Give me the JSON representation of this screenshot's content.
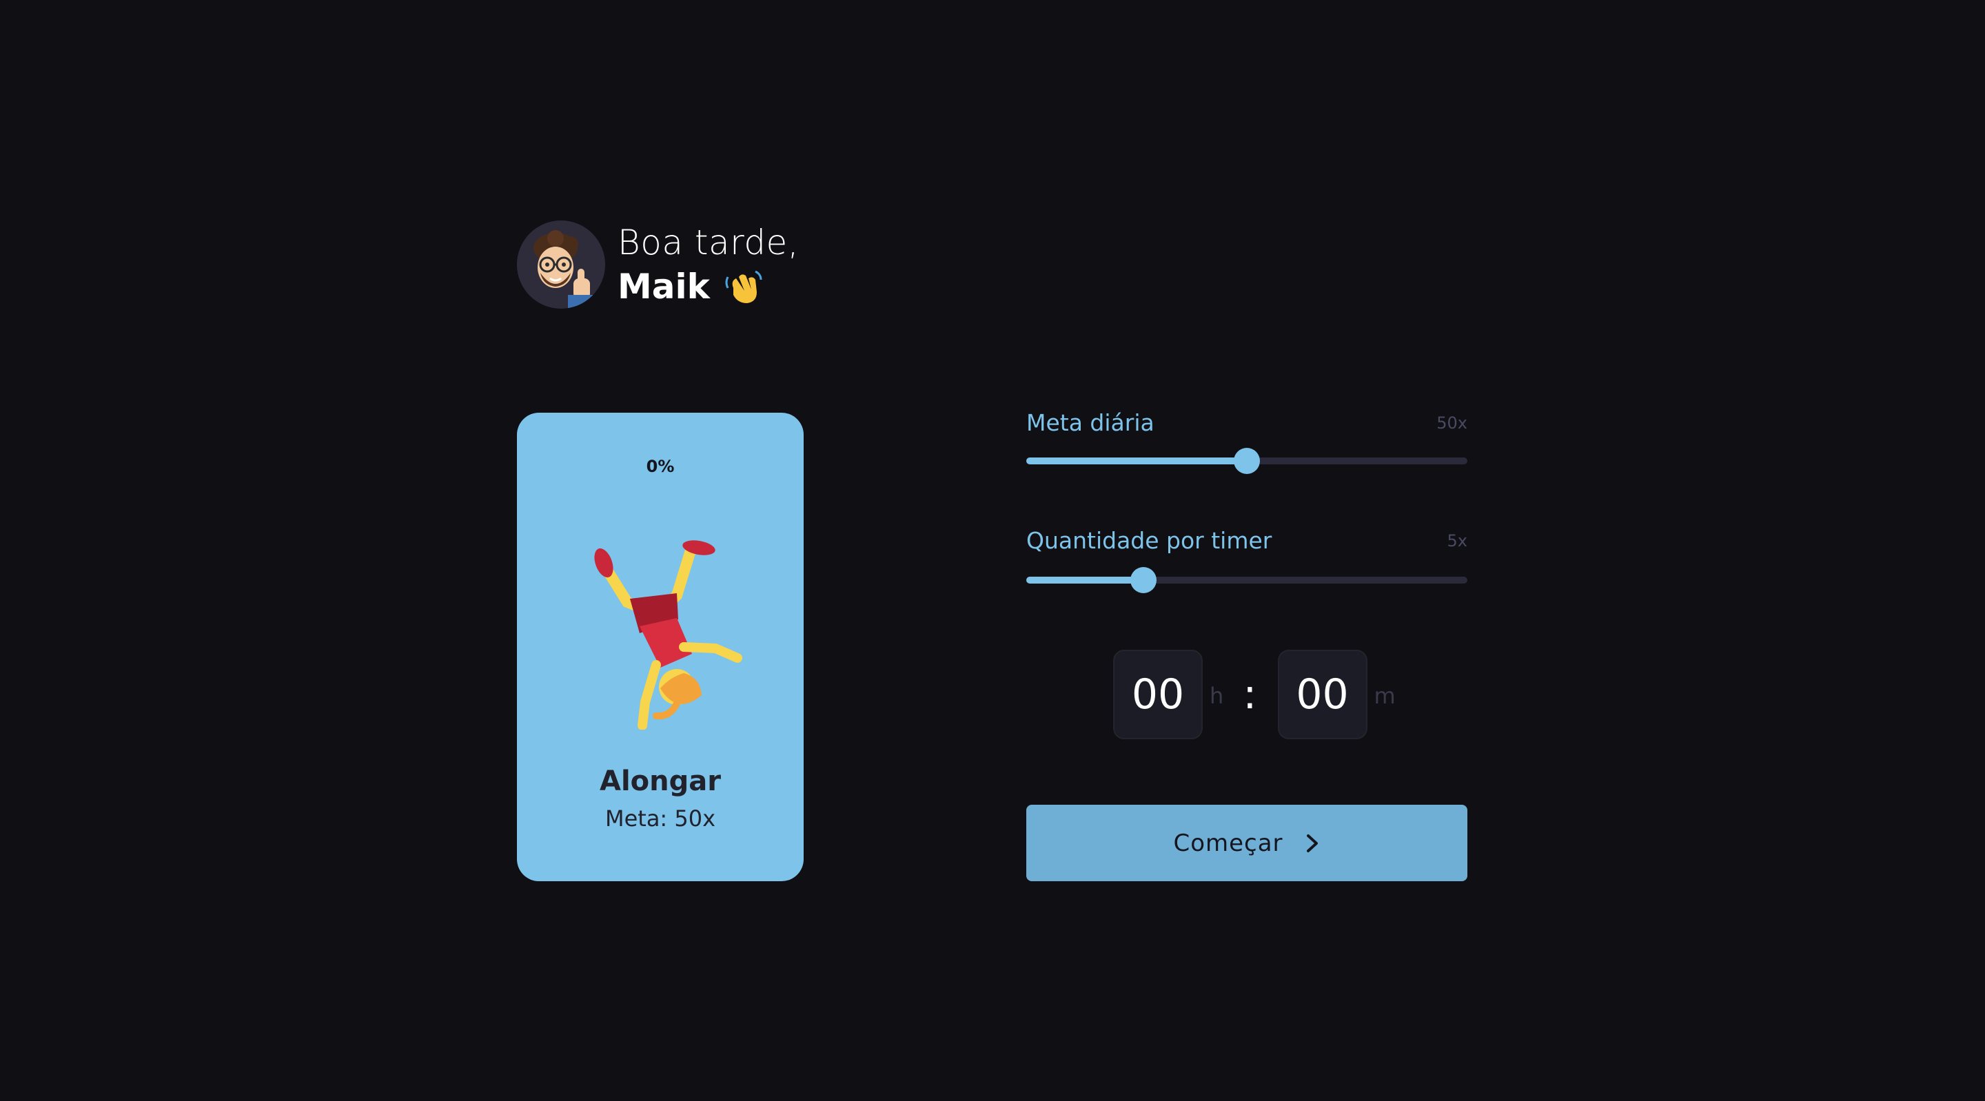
{
  "greeting": {
    "salutation": "Boa tarde,",
    "name": "Maik",
    "avatar_icon": "memoji-avatar",
    "wave_icon": "waving-hand-icon"
  },
  "activity_card": {
    "progress": "0%",
    "progress_value": 0,
    "title": "Alongar",
    "goal": "Meta: 50x",
    "illustration": "cartwheel-person-icon",
    "background": "#7ec3ea"
  },
  "settings": {
    "daily_goal": {
      "label": "Meta diária",
      "value": "50x",
      "fraction": 0.5
    },
    "per_timer": {
      "label": "Quantidade por timer",
      "value": "5x",
      "fraction": 0.265
    }
  },
  "timer": {
    "hours": "00",
    "hours_unit": "h",
    "separator": ":",
    "minutes": "00",
    "minutes_unit": "m"
  },
  "start_button": {
    "label": "Começar",
    "icon": "chevron-right-icon"
  },
  "colors": {
    "background": "#0f0f14",
    "accent": "#7ec3ea",
    "track": "#2a2a3a",
    "button": "#6fafd6"
  }
}
